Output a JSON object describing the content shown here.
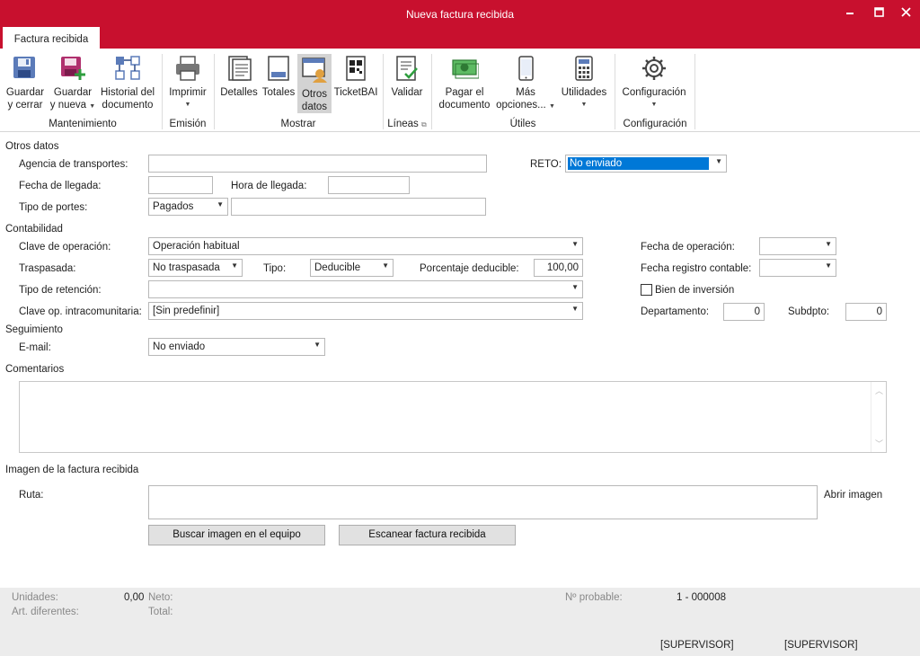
{
  "window": {
    "title": "Nueva factura recibida",
    "minimize": "🗕",
    "maximize": "🗖",
    "close": "✕"
  },
  "tabs": [
    {
      "label": "Factura recibida",
      "active": true
    }
  ],
  "ribbon": {
    "groups": {
      "mantenimiento": "Mantenimiento",
      "emision": "Emisión",
      "mostrar": "Mostrar",
      "lineas": "Líneas",
      "utiles": "Útiles",
      "configuracion": "Configuración"
    },
    "buttons": {
      "guardar_cerrar_1": "Guardar",
      "guardar_cerrar_2": "y cerrar",
      "guardar_nueva_1": "Guardar",
      "guardar_nueva_2": "y nueva",
      "historial_1": "Historial del",
      "historial_2": "documento",
      "imprimir": "Imprimir",
      "detalles": "Detalles",
      "totales": "Totales",
      "otros_datos_1": "Otros",
      "otros_datos_2": "datos",
      "ticketbai": "TicketBAI",
      "validar": "Validar",
      "pagar_1": "Pagar el",
      "pagar_2": "documento",
      "mas_1": "Más",
      "mas_2": "opciones...",
      "utilidades": "Utilidades",
      "configuracion": "Configuración"
    }
  },
  "otros_datos": {
    "section": "Otros datos",
    "agencia_label": "Agencia de transportes:",
    "agencia_value": "",
    "fecha_llegada_label": "Fecha de llegada:",
    "hora_llegada_label": "Hora de llegada:",
    "tipo_portes_label": "Tipo de portes:",
    "tipo_portes_value": "Pagados",
    "reto_label": "RETO:",
    "reto_value": "No enviado"
  },
  "contabilidad": {
    "section": "Contabilidad",
    "clave_operacion_label": "Clave de operación:",
    "clave_operacion_value": "Operación habitual",
    "traspasada_label": "Traspasada:",
    "traspasada_value": "No traspasada",
    "tipo_label": "Tipo:",
    "tipo_value": "Deducible",
    "porcentaje_label": "Porcentaje deducible:",
    "porcentaje_value": "100,00",
    "tipo_retencion_label": "Tipo de retención:",
    "tipo_retencion_value": "",
    "clave_intra_label": "Clave op. intracomunitaria:",
    "clave_intra_value": "[Sin predefinir]",
    "fecha_operacion_label": "Fecha de operación:",
    "fecha_registro_label": "Fecha registro contable:",
    "bien_inversion_label": "Bien de inversión",
    "departamento_label": "Departamento:",
    "departamento_value": "0",
    "subdpto_label": "Subdpto:",
    "subdpto_value": "0"
  },
  "seguimiento": {
    "section": "Seguimiento",
    "email_label": "E-mail:",
    "email_value": "No enviado"
  },
  "comentarios": {
    "section": "Comentarios",
    "value": ""
  },
  "imagen": {
    "section": "Imagen de la factura recibida",
    "ruta_label": "Ruta:",
    "abrir_imagen": "Abrir imagen",
    "buscar_button": "Buscar imagen en el equipo",
    "escanear_button": "Escanear factura recibida"
  },
  "status": {
    "unidades_label": "Unidades:",
    "unidades_value": "0,00",
    "art_diferentes_label": "Art. diferentes:",
    "neto_label": "Neto:",
    "total_label": "Total:",
    "n_probable_label": "Nº probable:",
    "n_probable_value": "1 - 000008",
    "user1": "[SUPERVISOR]",
    "user2": "[SUPERVISOR]"
  },
  "colors": {
    "brand": "#c8102e",
    "selection": "#0078d7"
  }
}
